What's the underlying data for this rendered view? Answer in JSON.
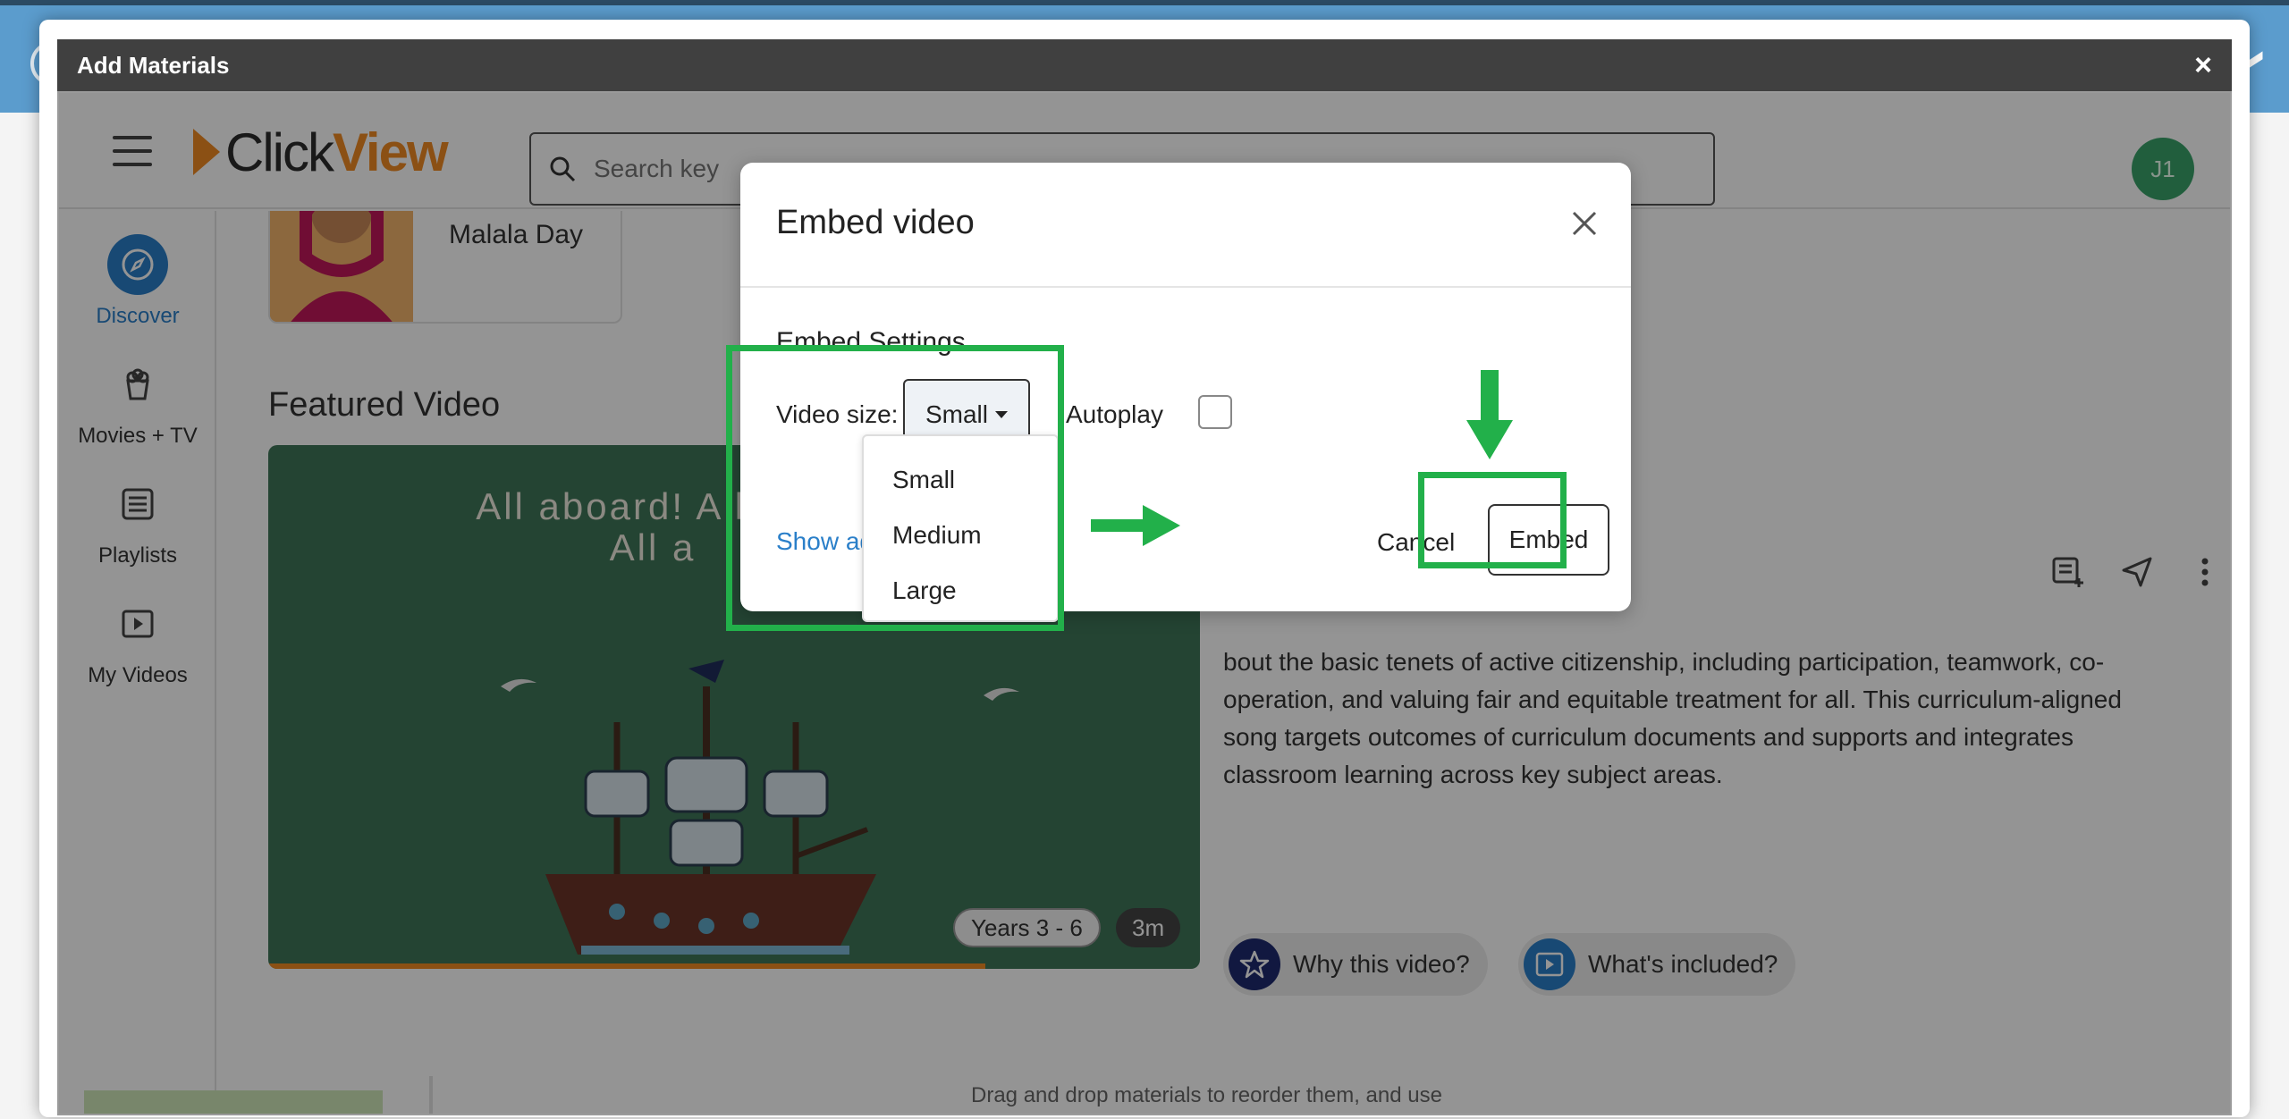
{
  "host": {
    "chevron": "❯"
  },
  "window": {
    "title": "Add Materials",
    "close_label": "×"
  },
  "app": {
    "logo_a": "Click",
    "logo_b": "View",
    "search_placeholder": "Search key",
    "avatar_initials": "J1",
    "nav": [
      {
        "label": "Discover",
        "icon": "compass-icon",
        "active": true
      },
      {
        "label": "Movies + TV",
        "icon": "popcorn-icon",
        "active": false
      },
      {
        "label": "Playlists",
        "icon": "list-icon",
        "active": false
      },
      {
        "label": "My Videos",
        "icon": "play-square-icon",
        "active": false
      }
    ],
    "card_title": "Malala Day",
    "featured_heading": "Featured Video",
    "video": {
      "caption_line1": "All aboard! All abo",
      "caption_line2": "All a",
      "years_badge": "Years 3 - 6",
      "duration_badge": "3m",
      "progress_fraction": 0.77
    },
    "description": "bout the basic tenets of active citizenship, including participation, teamwork, co-operation, and valuing fair and equitable treatment for all. This curriculum-aligned song targets outcomes of curriculum documents and supports and integrates classroom learning across key subject areas.",
    "pills": {
      "why": "Why this video?",
      "included": "What's included?"
    },
    "bottom_hint": "Drag and drop materials to reorder them, and use"
  },
  "modal": {
    "title": "Embed video",
    "section_title": "Embed Settings",
    "size_label": "Video size:",
    "size_selected": "Small",
    "size_options": [
      "Small",
      "Medium",
      "Large"
    ],
    "autoplay_label": "Autoplay",
    "autoplay_checked": false,
    "show_advanced": "Show advar",
    "cancel_label": "Cancel",
    "embed_label": "Embed"
  },
  "colors": {
    "accent_blue": "#2a7fc9",
    "brand_orange": "#f08a24",
    "highlight_green": "#22b04a"
  }
}
